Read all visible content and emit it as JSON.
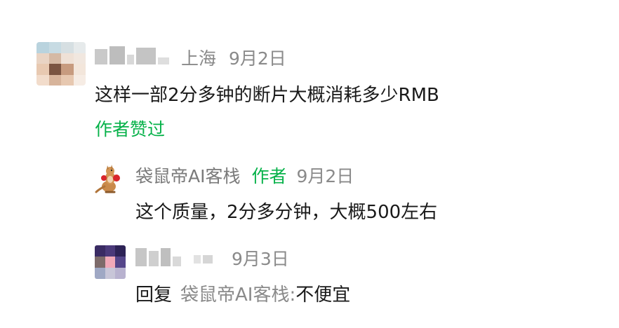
{
  "comment": {
    "location": "上海",
    "date": "9月2日",
    "text": "这样一部2分多钟的断片大概消耗多少RMB",
    "liked_label": "作者赞过"
  },
  "reply1": {
    "name": "袋鼠帝AI客栈",
    "author_tag": "作者",
    "date": "9月2日",
    "text": "这个质量，2分多分钟，大概500左右"
  },
  "reply2": {
    "date": "9月3日",
    "reply_prefix": "回复",
    "reply_target": "袋鼠帝AI客栈:",
    "text": "不便宜"
  },
  "colors": {
    "accent_green": "#07b24a",
    "meta_gray": "#8a8a8a",
    "text": "#191919"
  }
}
